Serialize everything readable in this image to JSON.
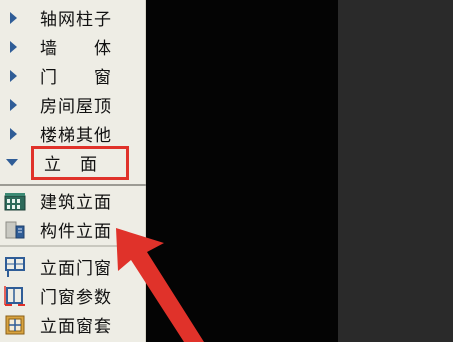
{
  "menu": {
    "items": [
      {
        "label": "轴网柱子",
        "icon": "collapsed-arrow-icon"
      },
      {
        "label": "墙　　体",
        "icon": "collapsed-arrow-icon"
      },
      {
        "label": "门　　窗",
        "icon": "collapsed-arrow-icon"
      },
      {
        "label": "房间屋顶",
        "icon": "collapsed-arrow-icon"
      },
      {
        "label": "楼梯其他",
        "icon": "collapsed-arrow-icon"
      },
      {
        "label": "立　面",
        "icon": "expanded-arrow-icon"
      }
    ],
    "sub_items": [
      {
        "label": "建筑立面",
        "icon": "building-elevation-icon"
      },
      {
        "label": "构件立面",
        "icon": "component-elevation-icon"
      },
      {
        "label": "立面门窗",
        "icon": "elevation-door-window-icon"
      },
      {
        "label": "门窗参数",
        "icon": "door-window-params-icon"
      },
      {
        "label": "立面窗套",
        "icon": "window-casing-icon"
      }
    ]
  },
  "colors": {
    "highlight": "#e0322a",
    "arrow": "#e0322a",
    "tree_arrow": "#2f5d97",
    "panel_bg": "#eeede5"
  }
}
